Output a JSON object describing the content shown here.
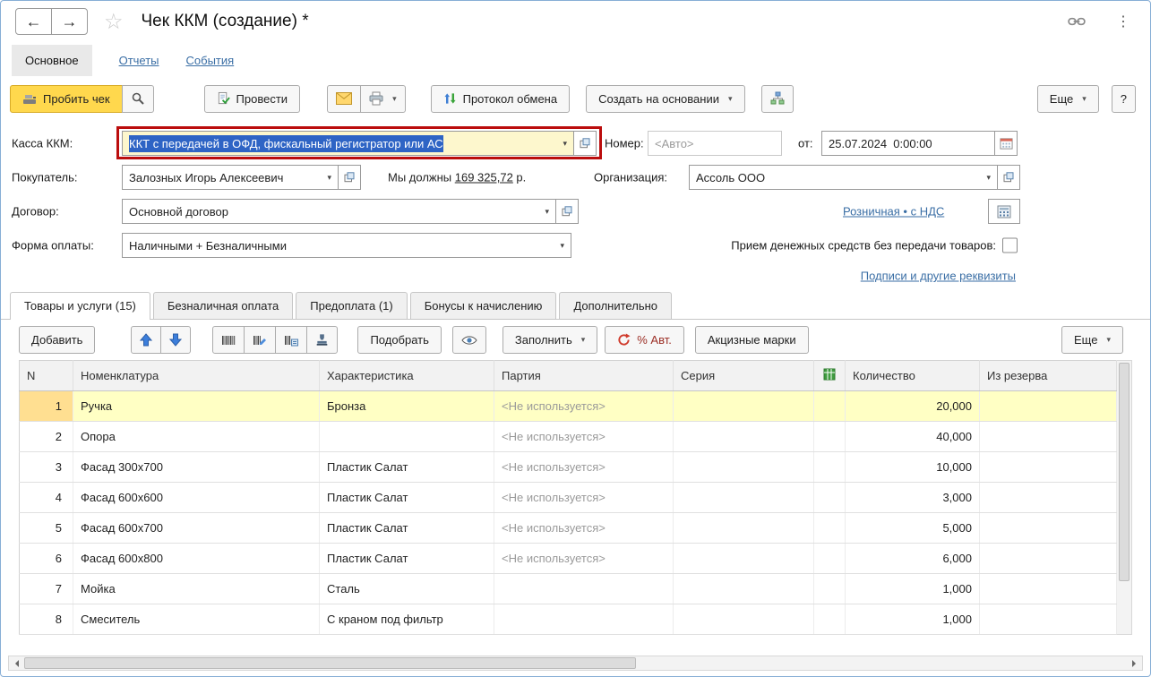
{
  "glyphs": {
    "back": "←",
    "forward": "→",
    "star": "☆",
    "dots": "⋮",
    "caret": "▾"
  },
  "window": {
    "title": "Чек ККМ (создание) *"
  },
  "nav": [
    {
      "label": "Основное"
    },
    {
      "label": "Отчеты"
    },
    {
      "label": "События"
    }
  ],
  "cmdbar": {
    "print_check": "Пробить чек",
    "post": "Провести",
    "exchange_protocol": "Протокол обмена",
    "create_based_on": "Создать на основании",
    "more": "Еще",
    "help": "?"
  },
  "form": {
    "kassa_label": "Касса ККМ:",
    "kassa_value": "ККТ с передачей в ОФД, фискальный регистратор или АС",
    "number_label": "Номер:",
    "number_placeholder": "<Авто>",
    "date_label": "от:",
    "date_value": "25.07.2024  0:00:00",
    "buyer_label": "Покупатель:",
    "buyer_value": "Залозных Игорь Алексеевич",
    "debt_prefix": "Мы должны ",
    "debt_amount": "169 325,72",
    "debt_suffix": " р.",
    "org_label": "Организация:",
    "org_value": "Ассоль ООО",
    "contract_label": "Договор:",
    "contract_value": "Основной договор",
    "price_type_link": "Розничная • с НДС",
    "payment_label": "Форма оплаты:",
    "payment_value": "Наличными + Безналичными",
    "no_goods_label": "Прием денежных средств без передачи товаров:",
    "signatures_link": "Подписи и другие реквизиты"
  },
  "tabs": [
    {
      "label": "Товары и услуги (15)",
      "active": true
    },
    {
      "label": "Безналичная оплата"
    },
    {
      "label": "Предоплата (1)"
    },
    {
      "label": "Бонусы к начислению"
    },
    {
      "label": "Дополнительно"
    }
  ],
  "table_toolbar": {
    "add": "Добавить",
    "pick": "Подобрать",
    "fill": "Заполнить",
    "auto_discount": "% Авт.",
    "excise": "Акцизные марки",
    "more": "Еще"
  },
  "table": {
    "columns": [
      {
        "label": "N"
      },
      {
        "label": "Номенклатура"
      },
      {
        "label": "Характеристика"
      },
      {
        "label": "Партия"
      },
      {
        "label": "Серия"
      },
      {
        "label": ""
      },
      {
        "label": "Количество"
      },
      {
        "label": "Из резерва"
      }
    ],
    "rows": [
      {
        "n": "1",
        "nomenclature": "Ручка",
        "characteristic": "Бронза",
        "batch": "<Не используется>",
        "series": "",
        "flag": "",
        "quantity": "20,000",
        "reserve": "",
        "selected": true
      },
      {
        "n": "2",
        "nomenclature": "Опора",
        "characteristic": "",
        "batch": "<Не используется>",
        "series": "",
        "flag": "",
        "quantity": "40,000",
        "reserve": ""
      },
      {
        "n": "3",
        "nomenclature": "Фасад 300x700",
        "characteristic": "Пластик Салат",
        "batch": "<Не используется>",
        "series": "",
        "flag": "",
        "quantity": "10,000",
        "reserve": ""
      },
      {
        "n": "4",
        "nomenclature": "Фасад 600x600",
        "characteristic": "Пластик Салат",
        "batch": "<Не используется>",
        "series": "",
        "flag": "",
        "quantity": "3,000",
        "reserve": ""
      },
      {
        "n": "5",
        "nomenclature": "Фасад 600x700",
        "characteristic": "Пластик Салат",
        "batch": "<Не используется>",
        "series": "",
        "flag": "",
        "quantity": "5,000",
        "reserve": ""
      },
      {
        "n": "6",
        "nomenclature": "Фасад 600x800",
        "characteristic": "Пластик Салат",
        "batch": "<Не используется>",
        "series": "",
        "flag": "",
        "quantity": "6,000",
        "reserve": ""
      },
      {
        "n": "7",
        "nomenclature": "Мойка",
        "characteristic": "Сталь",
        "batch": "",
        "series": "",
        "flag": "",
        "quantity": "1,000",
        "reserve": ""
      },
      {
        "n": "8",
        "nomenclature": "Смеситель",
        "characteristic": "С краном под фильтр",
        "batch": "",
        "series": "",
        "flag": "",
        "quantity": "1,000",
        "reserve": ""
      }
    ]
  }
}
